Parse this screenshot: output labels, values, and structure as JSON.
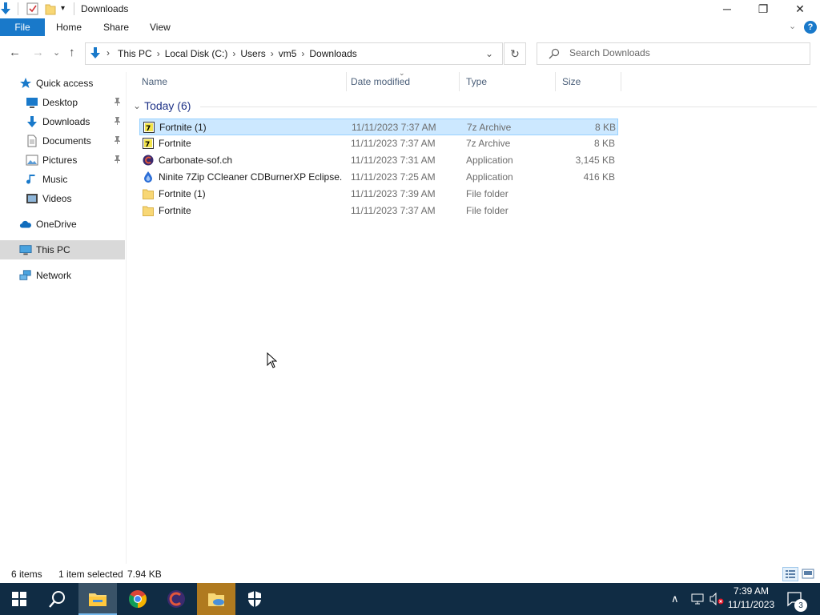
{
  "window": {
    "title": "Downloads",
    "minimize_glyph": "─",
    "restore_glyph": "❐",
    "close_glyph": "✕"
  },
  "ribbon": {
    "tabs": [
      "File",
      "Home",
      "Share",
      "View"
    ],
    "collapse_glyph": "⌄",
    "help_glyph": "?"
  },
  "nav": {
    "back_glyph": "←",
    "forward_glyph": "→",
    "recent_glyph": "⌄",
    "up_glyph": "↑",
    "dropdown_glyph": "⌄",
    "refresh_glyph": "↻",
    "breadcrumb": [
      "This PC",
      "Local Disk (C:)",
      "Users",
      "vm5",
      "Downloads"
    ],
    "breadcrumb_sep": "›",
    "search_placeholder": "Search Downloads"
  },
  "sidebar": {
    "items": [
      {
        "label": "Quick access",
        "icon": "star-icon",
        "pinned": false,
        "indent": 1,
        "selected": false
      },
      {
        "label": "Desktop",
        "icon": "desktop-icon",
        "pinned": true,
        "indent": 2,
        "selected": false
      },
      {
        "label": "Downloads",
        "icon": "download-icon",
        "pinned": true,
        "indent": 2,
        "selected": false
      },
      {
        "label": "Documents",
        "icon": "documents-icon",
        "pinned": true,
        "indent": 2,
        "selected": false
      },
      {
        "label": "Pictures",
        "icon": "pictures-icon",
        "pinned": true,
        "indent": 2,
        "selected": false
      },
      {
        "label": "Music",
        "icon": "music-icon",
        "pinned": false,
        "indent": 2,
        "selected": false
      },
      {
        "label": "Videos",
        "icon": "videos-icon",
        "pinned": false,
        "indent": 2,
        "selected": false
      },
      {
        "label": "OneDrive",
        "icon": "onedrive-icon",
        "pinned": false,
        "indent": 1,
        "selected": false
      },
      {
        "label": "This PC",
        "icon": "this-pc-icon",
        "pinned": false,
        "indent": 1,
        "selected": true
      },
      {
        "label": "Network",
        "icon": "network-icon",
        "pinned": false,
        "indent": 1,
        "selected": false
      }
    ],
    "pin_glyph": "📌"
  },
  "columns": [
    "Name",
    "Date modified",
    "Type",
    "Size"
  ],
  "group": {
    "label": "Today (6)",
    "chevron": "⌄"
  },
  "files": [
    {
      "name": "Fortnite (1)",
      "date": "11/11/2023 7:37 AM",
      "type": "7z Archive",
      "size": "8 KB",
      "icon": "7z-archive-icon",
      "selected": true
    },
    {
      "name": "Fortnite",
      "date": "11/11/2023 7:37 AM",
      "type": "7z Archive",
      "size": "8 KB",
      "icon": "7z-archive-icon",
      "selected": false
    },
    {
      "name": "Carbonate-sof.ch",
      "date": "11/11/2023 7:31 AM",
      "type": "Application",
      "size": "3,145 KB",
      "icon": "carbonate-app-icon",
      "selected": false
    },
    {
      "name": "Ninite 7Zip CCleaner CDBurnerXP Eclipse...",
      "date": "11/11/2023 7:25 AM",
      "type": "Application",
      "size": "416 KB",
      "icon": "ninite-app-icon",
      "selected": false
    },
    {
      "name": "Fortnite (1)",
      "date": "11/11/2023 7:39 AM",
      "type": "File folder",
      "size": "",
      "icon": "folder-icon",
      "selected": false
    },
    {
      "name": "Fortnite",
      "date": "11/11/2023 7:37 AM",
      "type": "File folder",
      "size": "",
      "icon": "folder-icon",
      "selected": false
    }
  ],
  "status": {
    "count": "6 items",
    "selection": "1 item selected",
    "selection_size": "7.94 KB"
  },
  "taskbar": {
    "time": "7:39 AM",
    "date": "11/11/2023",
    "notification_count": "3",
    "tray_chevron": "∧"
  },
  "colors": {
    "accent": "#1979ca",
    "selection_bg": "#cce8ff",
    "taskbar_bg": "#102c44",
    "folder": "#f8d775"
  }
}
